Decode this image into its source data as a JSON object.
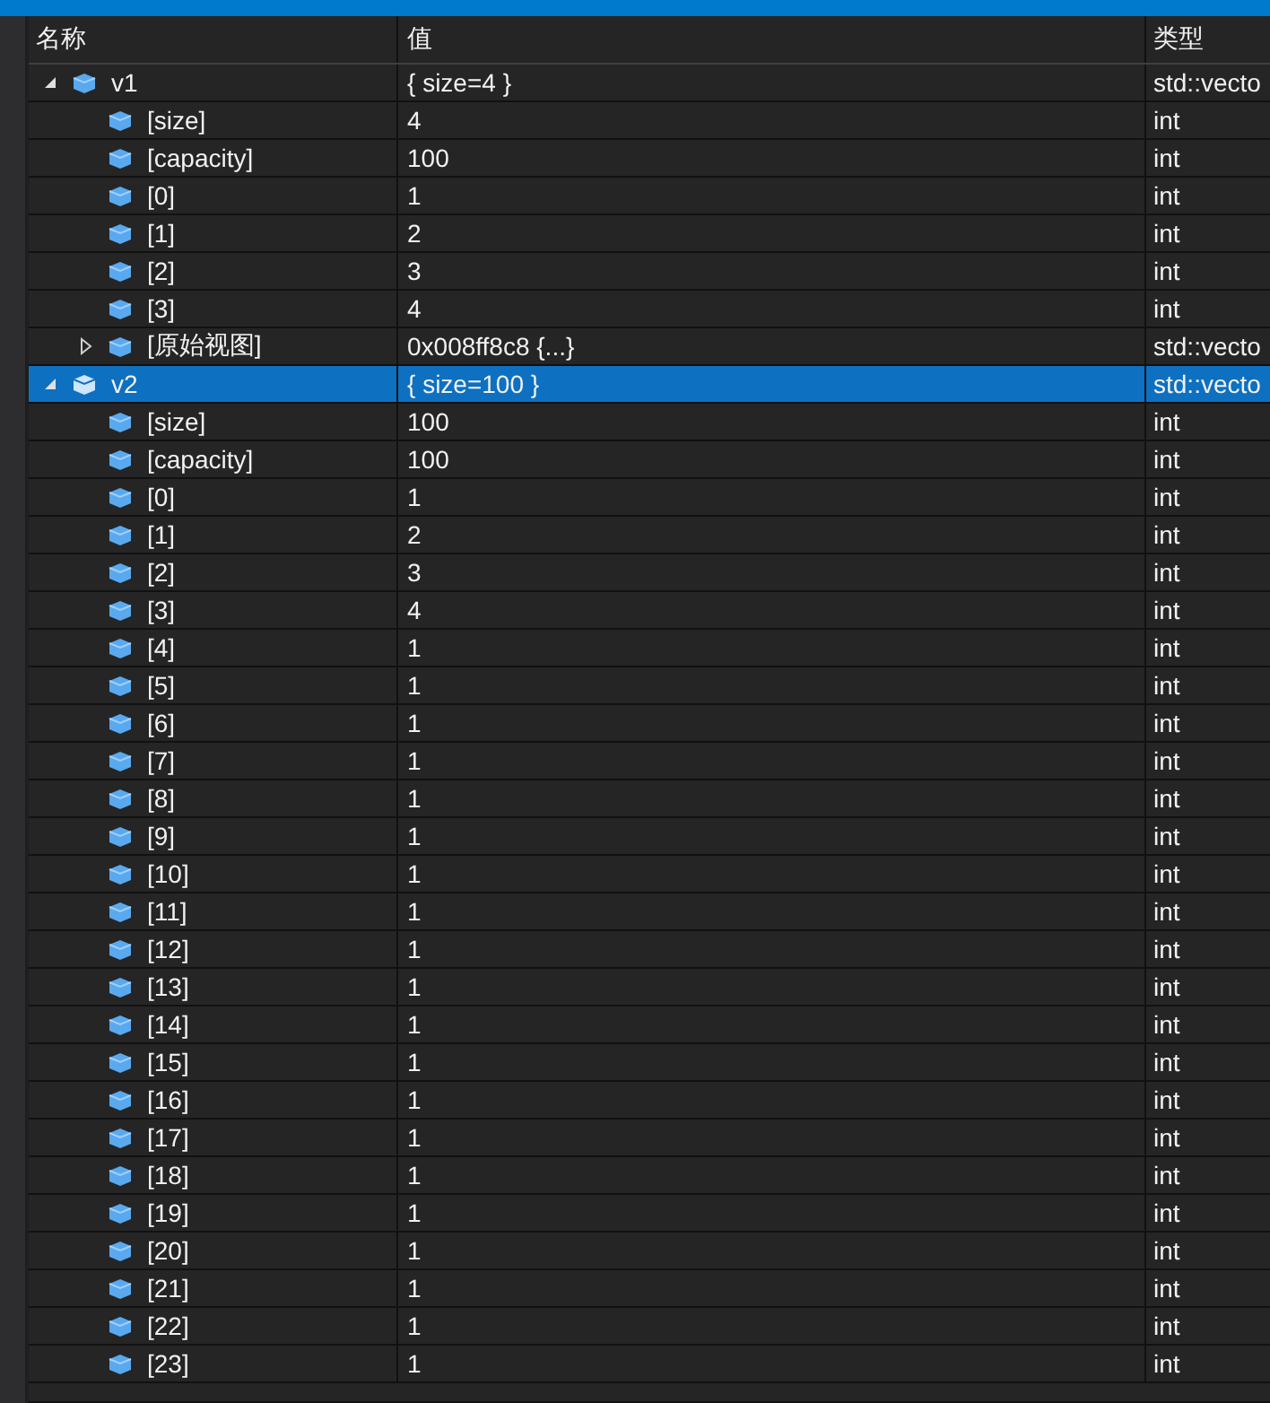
{
  "columns": [
    "名称",
    "值",
    "类型"
  ],
  "rows": [
    {
      "name": "v1",
      "value": "{ size=4 }",
      "type": "std::vecto",
      "expanded": true,
      "selected": false,
      "children": [
        {
          "name": "[size]",
          "value": "4",
          "type": "int",
          "selected": false
        },
        {
          "name": "[capacity]",
          "value": "100",
          "type": "int",
          "selected": false
        },
        {
          "name": "[0]",
          "value": "1",
          "type": "int",
          "selected": false
        },
        {
          "name": "[1]",
          "value": "2",
          "type": "int",
          "selected": false
        },
        {
          "name": "[2]",
          "value": "3",
          "type": "int",
          "selected": false
        },
        {
          "name": "[3]",
          "value": "4",
          "type": "int",
          "selected": false
        },
        {
          "name": "[原始视图]",
          "value": "0x008ff8c8 {...}",
          "type": "std::vecto",
          "expanded": false,
          "selected": false
        }
      ]
    },
    {
      "name": "v2",
      "value": "{ size=100 }",
      "type": "std::vecto",
      "expanded": true,
      "selected": true,
      "children": [
        {
          "name": "[size]",
          "value": "100",
          "type": "int",
          "selected": false
        },
        {
          "name": "[capacity]",
          "value": "100",
          "type": "int",
          "selected": false
        },
        {
          "name": "[0]",
          "value": "1",
          "type": "int",
          "selected": false
        },
        {
          "name": "[1]",
          "value": "2",
          "type": "int",
          "selected": false
        },
        {
          "name": "[2]",
          "value": "3",
          "type": "int",
          "selected": false
        },
        {
          "name": "[3]",
          "value": "4",
          "type": "int",
          "selected": false
        },
        {
          "name": "[4]",
          "value": "1",
          "type": "int",
          "selected": false
        },
        {
          "name": "[5]",
          "value": "1",
          "type": "int",
          "selected": false
        },
        {
          "name": "[6]",
          "value": "1",
          "type": "int",
          "selected": false
        },
        {
          "name": "[7]",
          "value": "1",
          "type": "int",
          "selected": false
        },
        {
          "name": "[8]",
          "value": "1",
          "type": "int",
          "selected": false
        },
        {
          "name": "[9]",
          "value": "1",
          "type": "int",
          "selected": false
        },
        {
          "name": "[10]",
          "value": "1",
          "type": "int",
          "selected": false
        },
        {
          "name": "[11]",
          "value": "1",
          "type": "int",
          "selected": false
        },
        {
          "name": "[12]",
          "value": "1",
          "type": "int",
          "selected": false
        },
        {
          "name": "[13]",
          "value": "1",
          "type": "int",
          "selected": false
        },
        {
          "name": "[14]",
          "value": "1",
          "type": "int",
          "selected": false
        },
        {
          "name": "[15]",
          "value": "1",
          "type": "int",
          "selected": false
        },
        {
          "name": "[16]",
          "value": "1",
          "type": "int",
          "selected": false
        },
        {
          "name": "[17]",
          "value": "1",
          "type": "int",
          "selected": false
        },
        {
          "name": "[18]",
          "value": "1",
          "type": "int",
          "selected": false
        },
        {
          "name": "[19]",
          "value": "1",
          "type": "int",
          "selected": false
        },
        {
          "name": "[20]",
          "value": "1",
          "type": "int",
          "selected": false
        },
        {
          "name": "[21]",
          "value": "1",
          "type": "int",
          "selected": false
        },
        {
          "name": "[22]",
          "value": "1",
          "type": "int",
          "selected": false
        },
        {
          "name": "[23]",
          "value": "1",
          "type": "int",
          "selected": false
        }
      ]
    }
  ]
}
